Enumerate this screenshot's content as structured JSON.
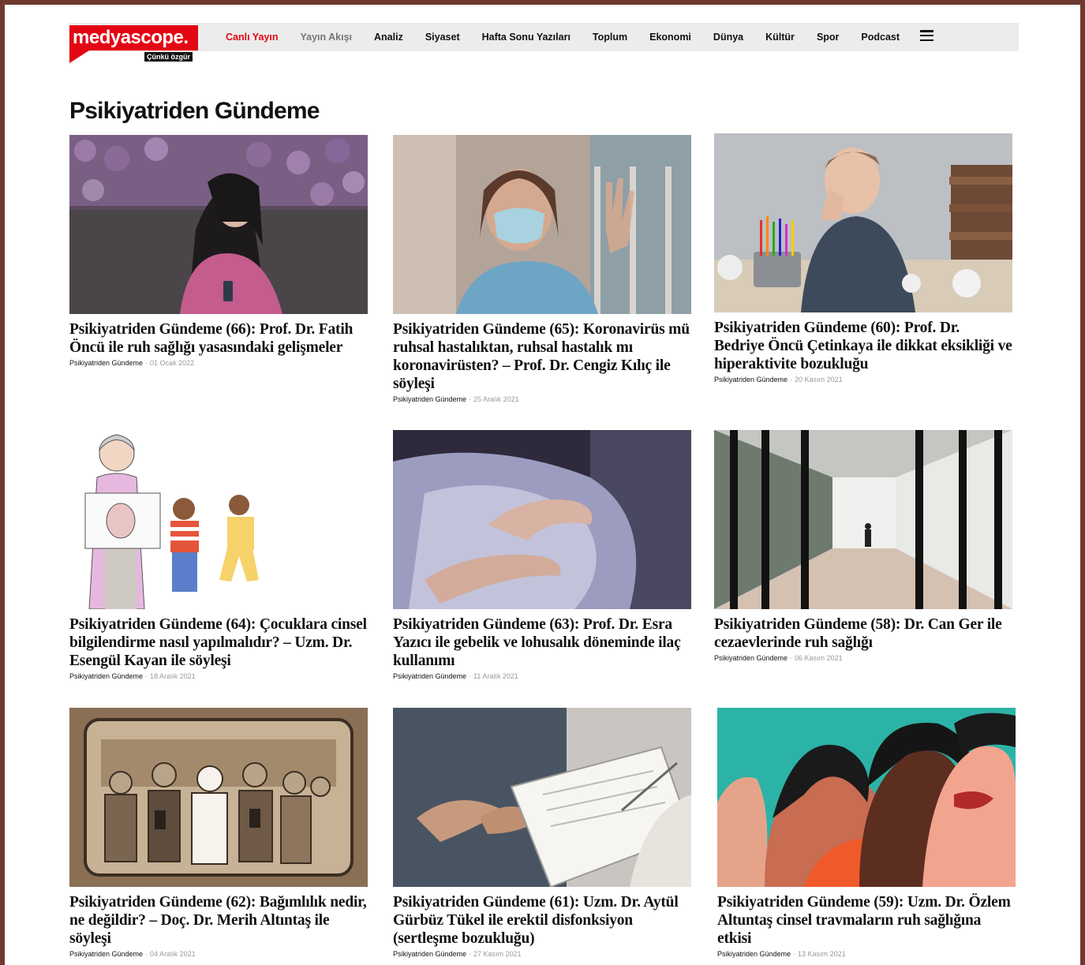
{
  "brand": {
    "logo_text": "medyascope.",
    "tagline": "Çünkü özgür"
  },
  "nav": {
    "items": [
      {
        "label": "Canlı Yayın",
        "kind": "live"
      },
      {
        "label": "Yayın Akışı",
        "kind": "schedule"
      },
      {
        "label": "Analiz",
        "kind": "normal"
      },
      {
        "label": "Siyaset",
        "kind": "normal"
      },
      {
        "label": "Hafta Sonu Yazıları",
        "kind": "normal"
      },
      {
        "label": "Toplum",
        "kind": "normal"
      },
      {
        "label": "Ekonomi",
        "kind": "normal"
      },
      {
        "label": "Dünya",
        "kind": "normal"
      },
      {
        "label": "Kültür",
        "kind": "normal"
      },
      {
        "label": "Spor",
        "kind": "normal"
      },
      {
        "label": "Podcast",
        "kind": "normal"
      }
    ],
    "menu_icon": "hamburger-menu-icon"
  },
  "page": {
    "title": "Psikiyatriden Gündeme"
  },
  "articles": [
    {
      "title": "Psikiyatriden Gündeme (66): Prof. Dr. Fatih Öncü ile ruh sağlığı yasasındaki gelişmeler",
      "category": "Psikiyatriden Gündeme",
      "date": "01 Ocak 2022",
      "image": "girl-with-mask-photo"
    },
    {
      "title": "Psikiyatriden Gündeme (65): Koronavirüs mü ruhsal hastalıktan, ruhsal hastalık mı koronavirüsten? – Prof. Dr. Cengiz Kılıç ile söyleşi",
      "category": "Psikiyatriden Gündeme",
      "date": "25 Aralık 2021",
      "image": "woman-mask-window-photo"
    },
    {
      "title": "Psikiyatriden Gündeme (60): Prof. Dr. Bedriye Öncü Çetinkaya ile dikkat eksikliği ve hiperaktivite bozukluğu",
      "category": "Psikiyatriden Gündeme",
      "date": "20 Kasım 2021",
      "image": "bored-boy-desk-photo"
    },
    {
      "title": "Psikiyatriden Gündeme (64): Çocuklara cinsel bilgilendirme nasıl yapılmalıdır? – Uzm. Dr. Esengül Kayan ile söyleşi",
      "category": "Psikiyatriden Gündeme",
      "date": "18 Aralık 2021",
      "image": "children-illustration"
    },
    {
      "title": "Psikiyatriden Gündeme (63): Prof. Dr. Esra Yazıcı ile gebelik ve lohusalık döneminde ilaç kullanımı",
      "category": "Psikiyatriden Gündeme",
      "date": "11 Aralık 2021",
      "image": "hands-pillow-photo"
    },
    {
      "title": "Psikiyatriden Gündeme (58): Dr. Can Ger ile cezaevlerinde ruh sağlığı",
      "category": "Psikiyatriden Gündeme",
      "date": "06 Kasım 2021",
      "image": "prison-corridor-photo"
    },
    {
      "title": "Psikiyatriden Gündeme (62): Bağımlılık nedir, ne değildir? – Doç. Dr. Merih Altıntaş ile söyleşi",
      "category": "Psikiyatriden Gündeme",
      "date": "04 Aralık 2021",
      "image": "phones-crowd-illustration"
    },
    {
      "title": "Psikiyatriden Gündeme (61): Uzm. Dr. Aytül Gürbüz Tükel ile erektil disfonksiyon (sertleşme bozukluğu)",
      "category": "Psikiyatriden Gündeme",
      "date": "27 Kasım 2021",
      "image": "doctor-clipboard-photo"
    },
    {
      "title": "Psikiyatriden Gündeme (59): Uzm. Dr. Özlem Altuntaş cinsel travmaların ruh sağlığına etkisi",
      "category": "Psikiyatriden Gündeme",
      "date": "13 Kasım 2021",
      "image": "women-profiles-illustration"
    }
  ],
  "colors": {
    "brand_red": "#e30613",
    "nav_bg": "#ececec",
    "frame": "#6e3a30"
  }
}
